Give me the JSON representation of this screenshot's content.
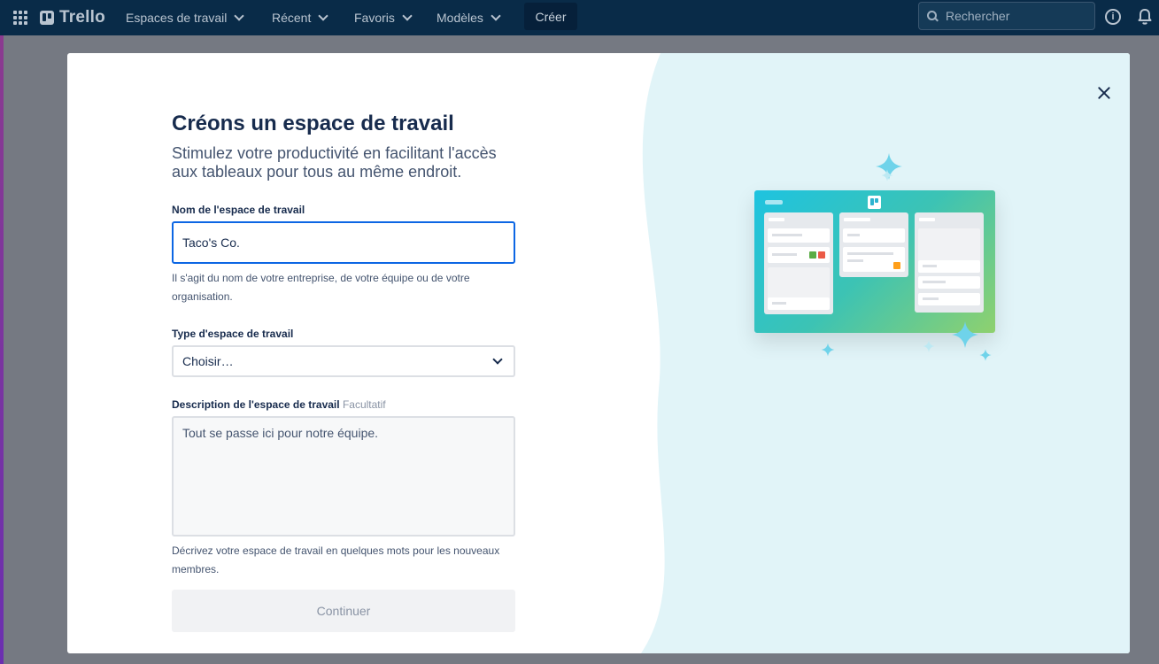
{
  "topbar": {
    "logo_text": "Trello",
    "nav": [
      {
        "label": "Espaces de travail"
      },
      {
        "label": "Récent"
      },
      {
        "label": "Favoris"
      },
      {
        "label": "Modèles"
      }
    ],
    "create_label": "Créer",
    "search_placeholder": "Rechercher",
    "icons": [
      "apps-grid-icon",
      "trello-logo-icon",
      "search-icon",
      "info-icon",
      "bell-icon"
    ]
  },
  "modal": {
    "title": "Créons un espace de travail",
    "subtitle": "Stimulez votre productivité en facilitant l'accès aux tableaux pour tous au même endroit.",
    "name_field": {
      "label": "Nom de l'espace de travail",
      "value": "Taco's Co.",
      "help": "Il s'agit du nom de votre entreprise, de votre équipe ou de votre organisation."
    },
    "type_field": {
      "label": "Type d'espace de travail",
      "selected": "Choisir…"
    },
    "description_field": {
      "label": "Description de l'espace de travail",
      "optional": "Facultatif",
      "placeholder": "Tout se passe ici pour notre équipe.",
      "help": "Décrivez votre espace de travail en quelques mots pour les nouveaux membres."
    },
    "continue_label": "Continuer",
    "close_icon": "close-icon"
  },
  "colors": {
    "topbar_bg": "#092b48",
    "panel_bg": "#e1f4f8",
    "accent_blue": "#0c66e4",
    "title_text": "#172b4d"
  }
}
